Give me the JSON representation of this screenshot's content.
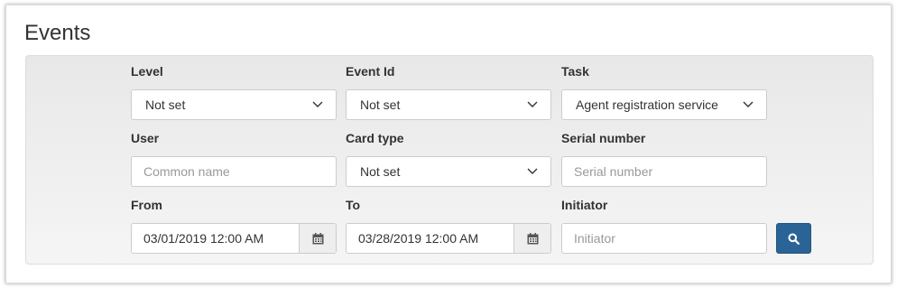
{
  "page": {
    "title": "Events"
  },
  "filters": {
    "level": {
      "label": "Level",
      "value": "Not set"
    },
    "event_id": {
      "label": "Event Id",
      "value": "Not set"
    },
    "task": {
      "label": "Task",
      "value": "Agent registration service"
    },
    "user": {
      "label": "User",
      "placeholder": "Common name",
      "value": ""
    },
    "card_type": {
      "label": "Card type",
      "value": "Not set"
    },
    "serial_number": {
      "label": "Serial number",
      "placeholder": "Serial number",
      "value": ""
    },
    "from": {
      "label": "From",
      "value": "03/01/2019 12:00 AM"
    },
    "to": {
      "label": "To",
      "value": "03/28/2019 12:00 AM"
    },
    "initiator": {
      "label": "Initiator",
      "placeholder": "Initiator",
      "value": ""
    }
  },
  "icons": {
    "chevron": "chevron-down-icon",
    "calendar": "calendar-icon",
    "search": "search-icon"
  },
  "colors": {
    "search_button": "#2a6496",
    "panel_background": "#eeeeee"
  }
}
